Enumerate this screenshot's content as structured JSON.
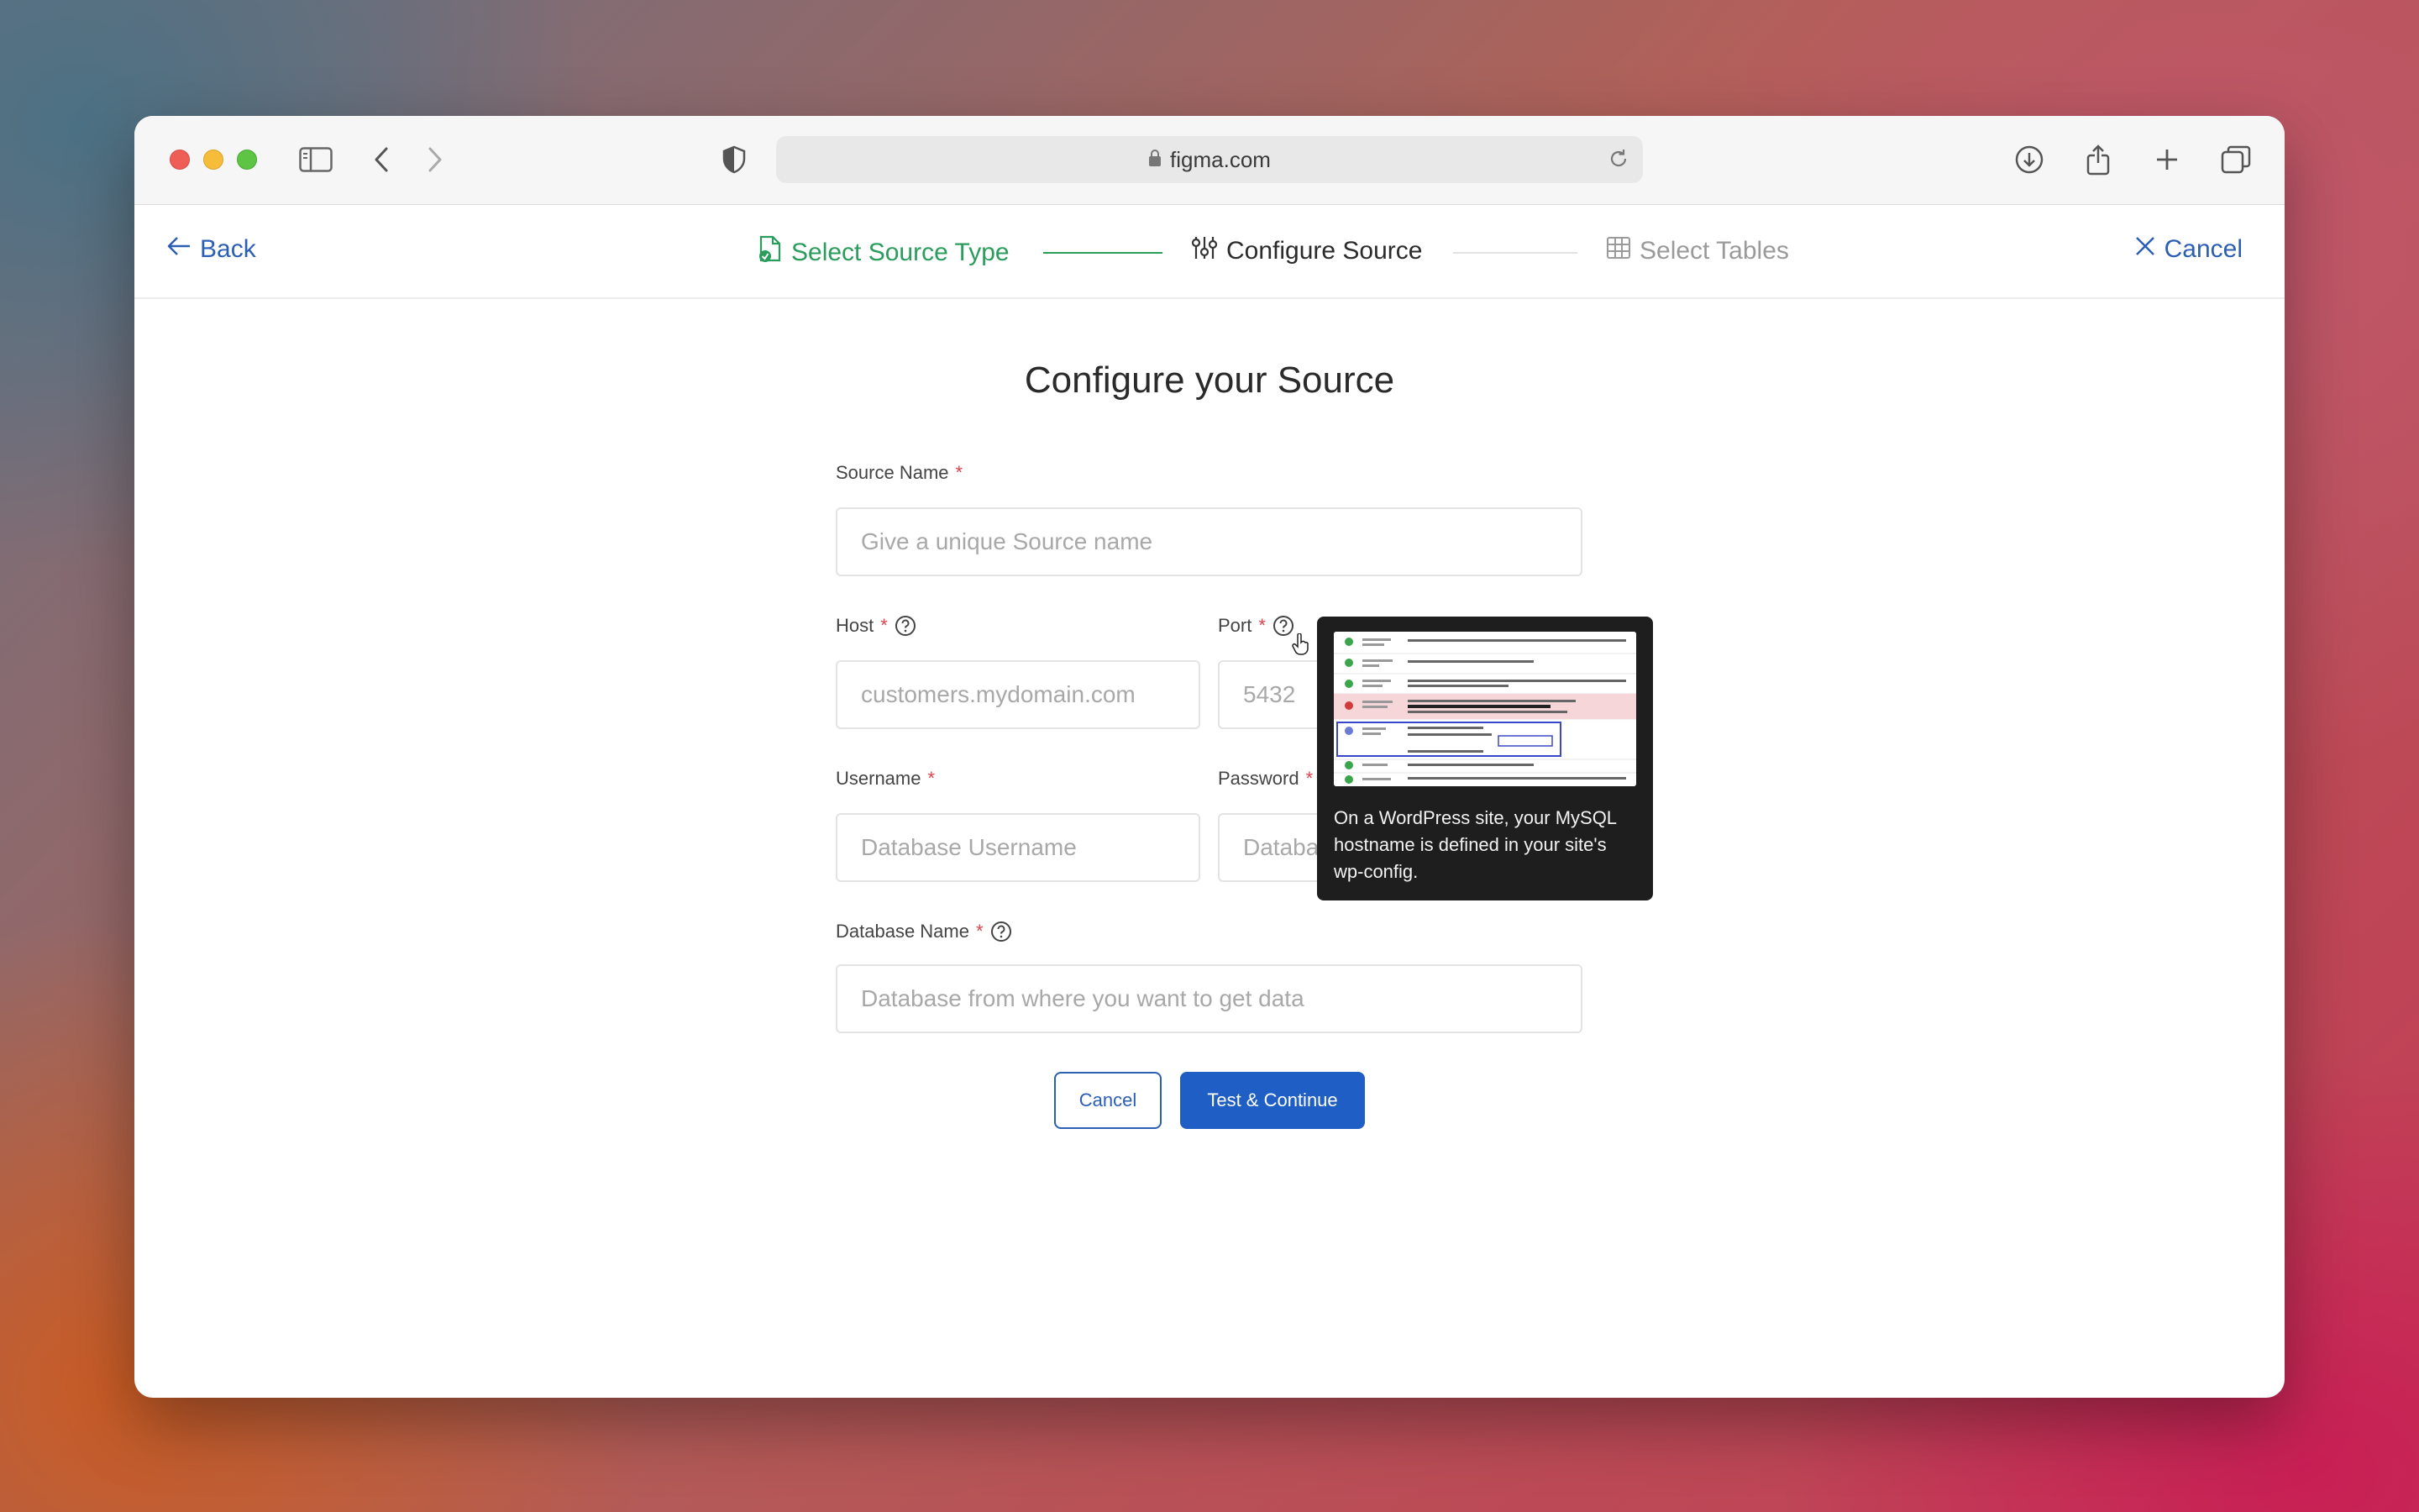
{
  "browser": {
    "url": "figma.com"
  },
  "stepper": {
    "back_label": "Back",
    "cancel_label": "Cancel",
    "steps": [
      {
        "label": "Select Source Type",
        "state": "done"
      },
      {
        "label": "Configure Source",
        "state": "active"
      },
      {
        "label": "Select Tables",
        "state": "pending"
      }
    ]
  },
  "form": {
    "title": "Configure your Source",
    "source_name": {
      "label": "Source Name",
      "required_mark": "*",
      "placeholder": "Give a unique Source name",
      "value": ""
    },
    "host": {
      "label": "Host",
      "required_mark": "*",
      "placeholder": "customers.mydomain.com",
      "value": ""
    },
    "port": {
      "label": "Port",
      "required_mark": "*",
      "placeholder": "5432",
      "value": ""
    },
    "username": {
      "label": "Username",
      "required_mark": "*",
      "placeholder": "Database Username",
      "value": ""
    },
    "password": {
      "label": "Password",
      "required_mark": "*",
      "placeholder": "Database Password",
      "value": ""
    },
    "database_name": {
      "label": "Database Name",
      "required_mark": "*",
      "placeholder": "Database from where you want to get data",
      "value": ""
    },
    "cancel_button": "Cancel",
    "submit_button": "Test & Continue"
  },
  "tooltip": {
    "text": "On a WordPress site, your MySQL hostname is defined in your site's wp-config."
  },
  "colors": {
    "accent_blue": "#1f5fc5",
    "link_blue": "#2a5fb4",
    "success_green": "#2a9d5c",
    "required_red": "#e0424c"
  }
}
